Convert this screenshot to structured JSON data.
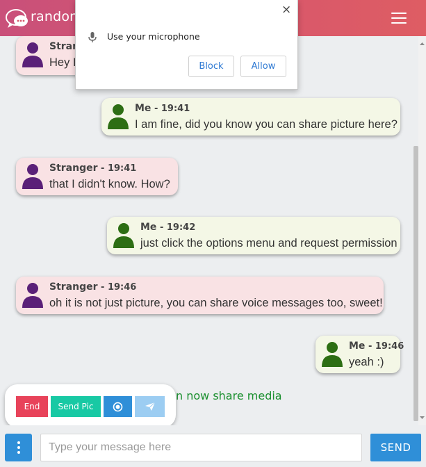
{
  "header": {
    "brand": "randome",
    "logo_icon": "chat-bubbles-icon",
    "menu_icon": "hamburger-icon"
  },
  "colors": {
    "header_start": "#c9507a",
    "header_end": "#de5d63",
    "stranger_bubble": "#f9e2e4",
    "me_bubble": "#f4f7e6",
    "stranger_avatar": "#5a2078",
    "me_avatar": "#2d6e14",
    "accent": "#2f8fd8",
    "notice": "#1a8f2e"
  },
  "messages": [
    {
      "sender": "Stranger",
      "time": "",
      "text": "Hey I",
      "side": "stranger"
    },
    {
      "sender": "Me",
      "time": " - 19:41",
      "text": "I am fine, did you know you can share picture here?",
      "side": "me"
    },
    {
      "sender": "Stranger",
      "time": " - 19:41",
      "text": "that I didn't know. How?",
      "side": "stranger"
    },
    {
      "sender": "Me",
      "time": " - 19:42",
      "text": "just click the options menu and request permission",
      "side": "me"
    },
    {
      "sender": "Stranger",
      "time": " - 19:46",
      "text": "oh it is not just picture, you can share voice messages too, sweet!",
      "side": "stranger"
    },
    {
      "sender": "Me",
      "time": " - 19:46",
      "text": "yeah :)",
      "side": "me"
    }
  ],
  "notice": "n now share media",
  "options": {
    "end": "End",
    "send_pic": "Send Pic",
    "record_icon": "record-icon",
    "send_voice_icon": "paper-plane-icon"
  },
  "composer": {
    "placeholder": "Type your message here",
    "send": "SEND",
    "menu_icon": "vertical-dots-icon"
  },
  "permission_dialog": {
    "text": "Use your microphone",
    "block": "Block",
    "allow": "Allow",
    "close": "×",
    "mic_icon": "microphone-icon"
  }
}
